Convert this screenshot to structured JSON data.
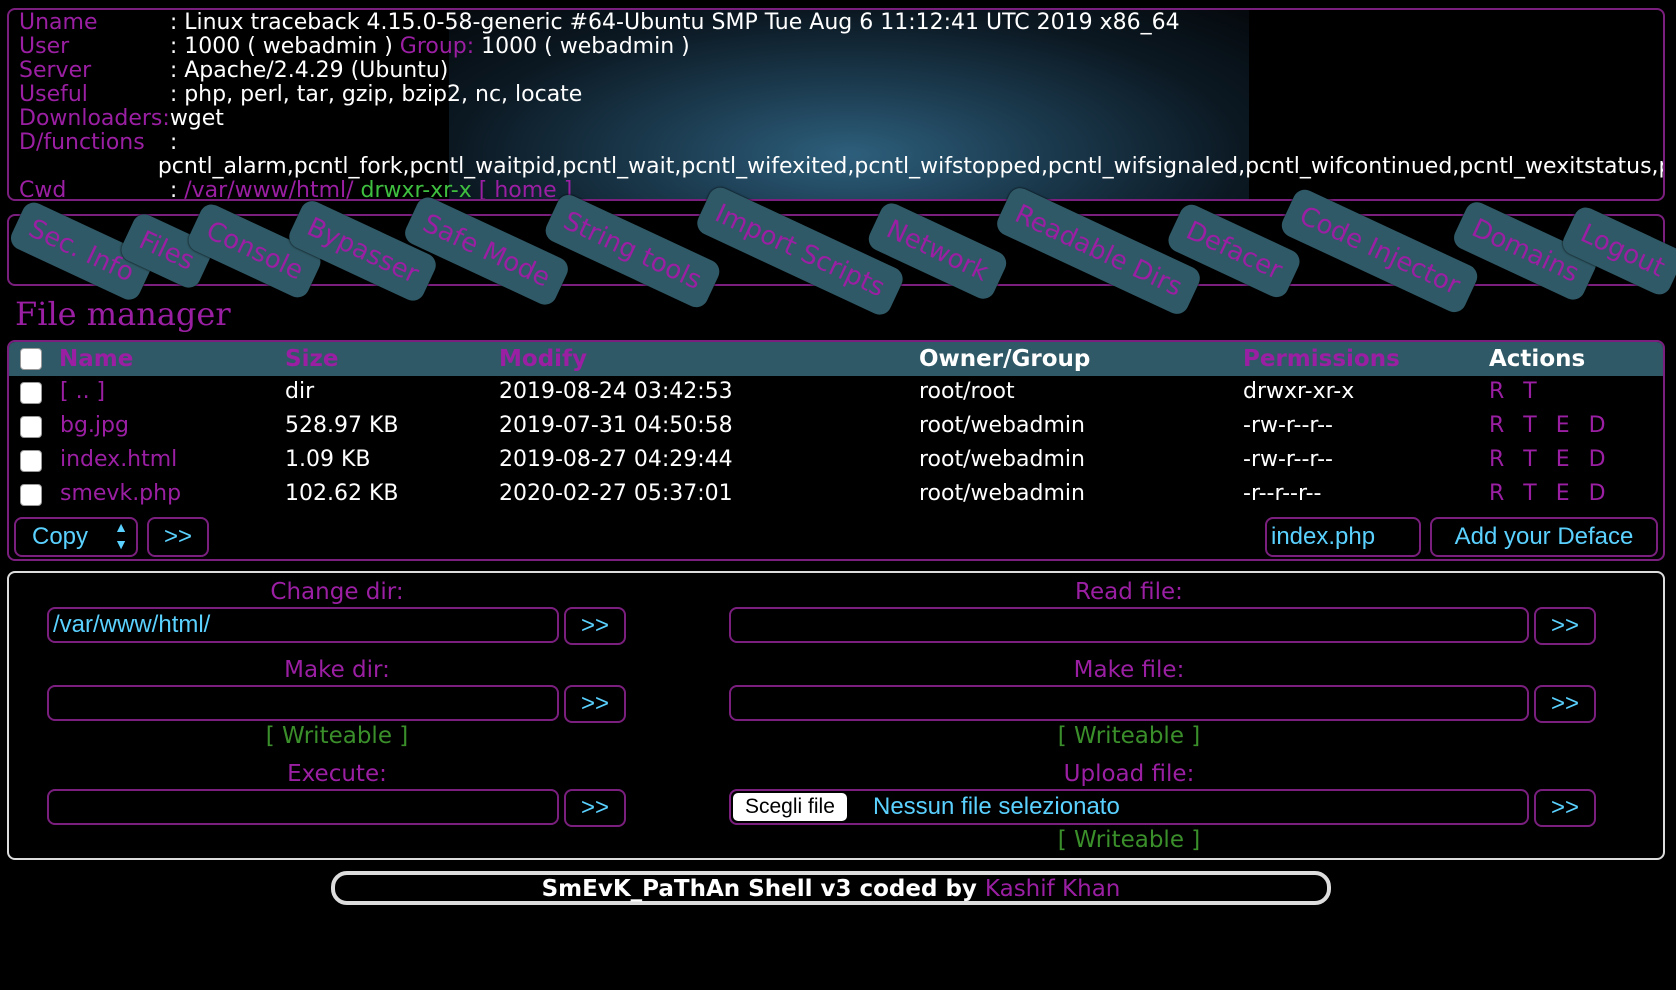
{
  "info": {
    "uname_label": "Uname",
    "uname_value": ": Linux traceback 4.15.0-58-generic #64-Ubuntu SMP Tue Aug 6 11:12:41 UTC 2019 x86_64",
    "user_label": "User",
    "user_value": ": 1000 ( webadmin )",
    "group_label": "Group:",
    "group_value": "1000 ( webadmin )",
    "server_label": "Server",
    "server_value": ": Apache/2.4.29 (Ubuntu)",
    "useful_label": "Useful",
    "useful_value": ": php, perl, tar, gzip, bzip2, nc, locate",
    "downloaders_label": "Downloaders:",
    "downloaders_value": "wget",
    "dfunctions_label": "D/functions",
    "dfunctions_colon": ":",
    "dfunctions_value": "pcntl_alarm,pcntl_fork,pcntl_waitpid,pcntl_wait,pcntl_wifexited,pcntl_wifstopped,pcntl_wifsignaled,pcntl_wifcontinued,pcntl_wexitstatus,pcntl_wtermsig,pcntl_wstopsig",
    "cwd_label": "Cwd",
    "cwd_colon": ":",
    "cwd_path": "/var/www/html/",
    "cwd_perms": "drwxr-xr-x",
    "cwd_home": "[ home ]"
  },
  "nav": [
    "Sec. Info",
    "Files",
    "Console",
    "Bypasser",
    "Safe Mode",
    "String tools",
    "Import Scripts",
    "Network",
    "Readable Dirs",
    "Defacer",
    "Code Injector",
    "Domains",
    "Logout"
  ],
  "file_manager": {
    "title": "File manager",
    "headers": [
      "Name",
      "Size",
      "Modify",
      "Owner/Group",
      "Permissions",
      "Actions"
    ],
    "rows": [
      {
        "name": "[ .. ]",
        "size": "dir",
        "modify": "2019-08-24 03:42:53",
        "owner": "root/root",
        "perms": "drwxr-xr-x",
        "actions": "R T"
      },
      {
        "name": "bg.jpg",
        "size": "528.97 KB",
        "modify": "2019-07-31 04:50:58",
        "owner": "root/webadmin",
        "perms": "-rw-r--r--",
        "actions": "R T E D"
      },
      {
        "name": "index.html",
        "size": "1.09 KB",
        "modify": "2019-08-27 04:29:44",
        "owner": "root/webadmin",
        "perms": "-rw-r--r--",
        "actions": "R T E D"
      },
      {
        "name": "smevk.php",
        "size": "102.62 KB",
        "modify": "2020-02-27 05:37:01",
        "owner": "root/webadmin",
        "perms": "-r--r--r--",
        "actions": "R T E D"
      }
    ],
    "copy_select": "Copy",
    "go_label": ">>",
    "deface_filename": "index.php",
    "deface_button": "Add your Deface"
  },
  "tools": {
    "change_dir_label": "Change dir:",
    "change_dir_value": "/var/www/html/",
    "read_file_label": "Read file:",
    "make_dir_label": "Make dir:",
    "make_file_label": "Make file:",
    "writeable": "[ Writeable ]",
    "execute_label": "Execute:",
    "upload_label": "Upload file:",
    "choose_file": "Scegli file",
    "no_file": "Nessun file selezionato",
    "go_label": ">>"
  },
  "footer": {
    "text": "SmEvK_PaThAn Shell v3 coded by",
    "author": "Kashif Khan"
  },
  "colors": {
    "accent": "#9b1fa3",
    "tab_bg": "#2f5966",
    "input_text": "#5ad1ff",
    "writeable": "#3a8f2a"
  }
}
